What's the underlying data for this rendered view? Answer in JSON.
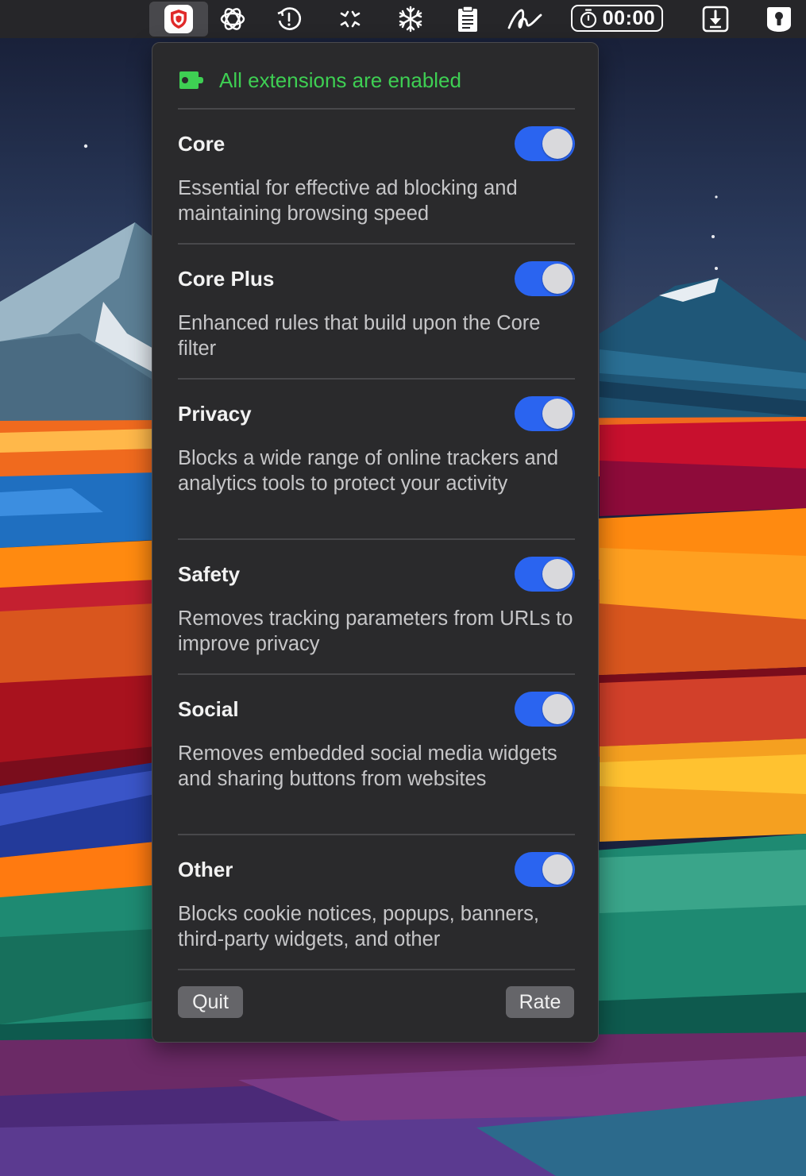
{
  "menubar": {
    "items": [
      {
        "name": "adblock-shield-icon",
        "active": true
      },
      {
        "name": "openai-icon"
      },
      {
        "name": "clock-alert-icon"
      },
      {
        "name": "shrink-arrows-icon"
      },
      {
        "name": "snowflake-icon"
      },
      {
        "name": "clipboard-icon"
      },
      {
        "name": "signature-icon"
      },
      {
        "name": "download-box-icon"
      },
      {
        "name": "keyhole-lock-icon"
      }
    ],
    "timer": "00:00"
  },
  "panel": {
    "status": "All extensions are enabled",
    "status_color": "#3ecf53",
    "toggle_color": "#2a64f0",
    "filters": [
      {
        "title": "Core",
        "description": "Essential for effective ad blocking and maintaining browsing speed",
        "enabled": true
      },
      {
        "title": "Core Plus",
        "description": "Enhanced rules that build upon the Core filter",
        "enabled": true
      },
      {
        "title": "Privacy",
        "description": "Blocks a wide range of online trackers and analytics tools to protect your activity",
        "enabled": true
      },
      {
        "title": "Safety",
        "description": "Removes tracking parameters from URLs to improve privacy",
        "enabled": true
      },
      {
        "title": "Social",
        "description": "Removes embedded social media widgets and sharing buttons from websites",
        "enabled": true
      },
      {
        "title": "Other",
        "description": "Blocks cookie notices, popups, banners, third-party widgets, and other",
        "enabled": true
      }
    ],
    "quit_label": "Quit",
    "rate_label": "Rate"
  }
}
